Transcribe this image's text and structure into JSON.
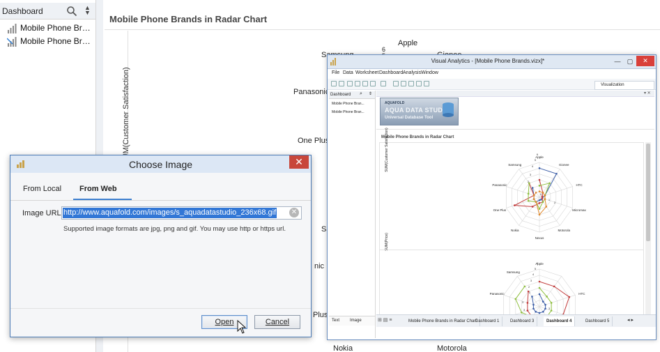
{
  "sidebar": {
    "title": "Dashboard",
    "items": [
      {
        "label": "Mobile Phone Brands in Radar Chart",
        "icon": "bar-chart-icon"
      },
      {
        "label": "Mobile Phone Brands in Radar Chart",
        "icon": "bar-chart-edit-icon"
      }
    ]
  },
  "main": {
    "title": "Mobile Phone Brands in Radar Chart",
    "y_axis_label": "SUM(Customer Satisfaction)",
    "bg_labels": [
      "Apple",
      "Samsung",
      "Gionee",
      "6",
      "5",
      "Panasonic",
      "One Plus",
      "Sa",
      "nic",
      "Plus",
      "Nokia",
      "Motorola"
    ]
  },
  "va_window": {
    "title": "Visual Analytics - [Mobile Phone Brands.vizx]*",
    "menu": [
      "File",
      "Data",
      "Worksheet",
      "Dashboard",
      "Analysis",
      "Window"
    ],
    "visualization_button": "Visualization",
    "left_title": "Dashboard",
    "left_items": [
      "Mobile Phone Bran...",
      "Mobile Phone Bran..."
    ],
    "text_button": "Text",
    "image_button": "Image",
    "logo": {
      "small": "AQUAFOLD",
      "big": "AQUA DATA STUDIO",
      "sub": "Universal Database Tool"
    },
    "chart_title": "Mobile Phone Brands in Radar Chart",
    "y_label_1": "SUM(Customer Satisfaction)",
    "y_label_2": "SUM(Price)",
    "tabs": [
      "Mobile Phone Brands in Radar Chart",
      "Dashboard 1",
      "Dashboard 3",
      "Dashboard 4",
      "Dashboard 5"
    ],
    "active_tab": "Dashboard 4",
    "radar1_labels": [
      "Apple",
      "Gionee",
      "HTC",
      "Micromax",
      "Motorola",
      "Nexus",
      "Nokia",
      "One Plus",
      "Panasonic",
      "Samsung"
    ],
    "radar1_ticks": [
      "6",
      "5",
      "4",
      "3",
      "2",
      "1",
      "0",
      "1",
      "2"
    ],
    "radar2_labels": [
      "Apple",
      "HTC",
      "Panasonic",
      "Samsung"
    ],
    "radar2_ticks": [
      "6",
      "5",
      "4",
      "3",
      "2",
      "1",
      "3",
      "3",
      "3"
    ]
  },
  "dialog": {
    "title": "Choose Image",
    "tab_local": "From Local",
    "tab_web": "From Web",
    "url_label": "Image URL",
    "url_value": "http://www.aquafold.com/images/s_aquadatastudio_236x68.gif",
    "hint": "Supported image formats are jpg, png and gif. You may use http or https url.",
    "open_label": "Open",
    "cancel_label": "Cancel"
  },
  "colors": {
    "accent": "#3277d6",
    "series_blue": "#3d5fa8",
    "series_red": "#c23b3b",
    "series_green": "#8fbf3f",
    "series_orange": "#e08a2e"
  }
}
